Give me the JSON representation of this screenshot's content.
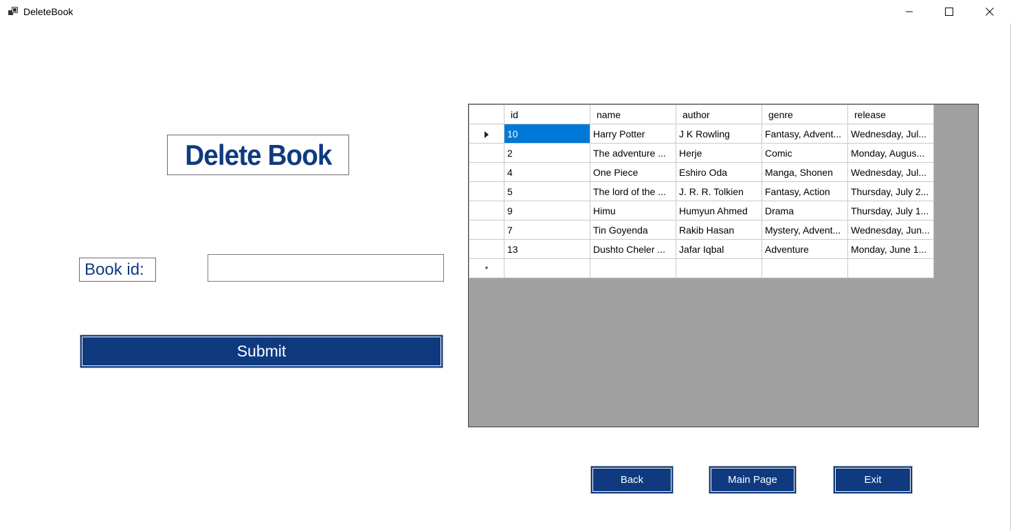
{
  "window": {
    "title": "DeleteBook",
    "minimize_glyph": "—",
    "maximize_glyph": "☐",
    "close_glyph": "✕"
  },
  "form": {
    "heading": "Delete Book",
    "book_id_label": "Book id:",
    "book_id_value": "",
    "submit_label": "Submit"
  },
  "grid": {
    "columns": [
      "id",
      "name",
      "author",
      "genre",
      "release"
    ],
    "rows": [
      {
        "id": "10",
        "name": "Harry Potter",
        "author": "J K Rowling",
        "genre": "Fantasy, Advent...",
        "release": "Wednesday, Jul..."
      },
      {
        "id": "2",
        "name": "The adventure ...",
        "author": "Herje",
        "genre": "Comic",
        "release": "Monday, Augus..."
      },
      {
        "id": "4",
        "name": "One Piece",
        "author": "Eshiro Oda",
        "genre": "Manga, Shonen",
        "release": "Wednesday, Jul..."
      },
      {
        "id": "5",
        "name": "The lord of the ...",
        "author": "J. R. R. Tolkien",
        "genre": "Fantasy, Action",
        "release": "Thursday, July 2..."
      },
      {
        "id": "9",
        "name": "Himu",
        "author": "Humyun Ahmed",
        "genre": "Drama",
        "release": "Thursday, July 1..."
      },
      {
        "id": "7",
        "name": "Tin Goyenda",
        "author": "Rakib Hasan",
        "genre": "Mystery, Advent...",
        "release": "Wednesday, Jun..."
      },
      {
        "id": "13",
        "name": "Dushto Cheler ...",
        "author": "Jafar Iqbal",
        "genre": "Adventure",
        "release": "Monday, June 1..."
      }
    ],
    "selected_row_index": 0,
    "new_row_marker": "*"
  },
  "buttons": {
    "back": "Back",
    "main_page": "Main Page",
    "exit": "Exit"
  },
  "colors": {
    "accent": "#0f3a80",
    "selection": "#0078d7",
    "grid_background": "#a0a0a0"
  }
}
